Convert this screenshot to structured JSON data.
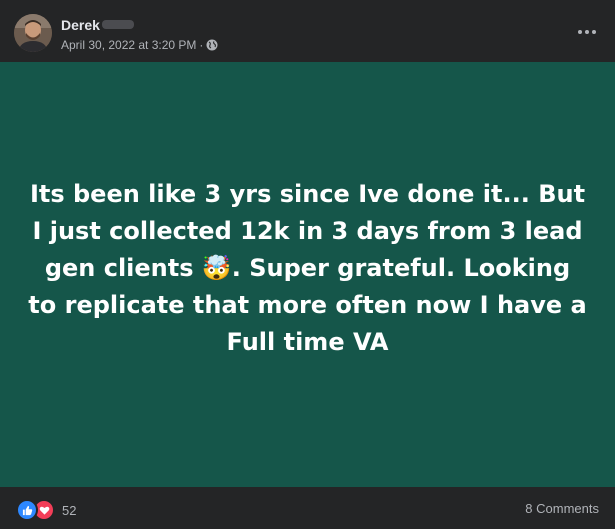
{
  "post": {
    "author": "Derek",
    "timestamp": "April 30, 2022 at 3:20 PM",
    "separator": "·",
    "privacy_icon": "globe-icon",
    "more_icon": "more-options-icon",
    "background_color": "#15564a",
    "text": "Its been like 3 yrs since Ive done it... But I just collected 12k in 3 days from 3 lead gen clients 🤯. Super grateful. Looking to replicate that more often now I have a Full time VA"
  },
  "footer": {
    "reaction_icons": [
      "like-icon",
      "love-icon"
    ],
    "reaction_count": "52",
    "comments_label": "8 Comments"
  }
}
